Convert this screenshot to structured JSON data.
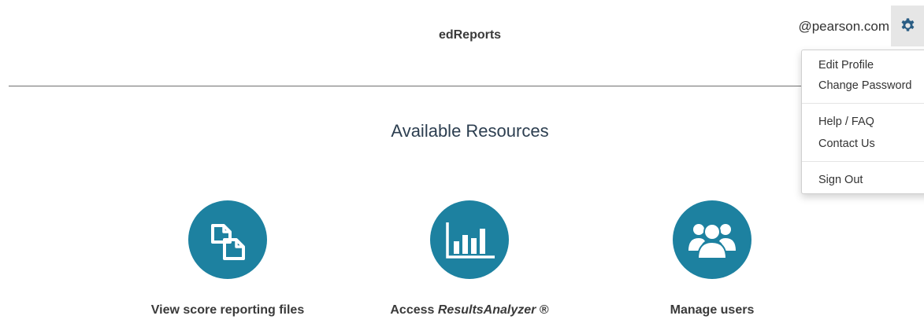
{
  "header": {
    "app_title": "edReports",
    "user_email": "@pearson.com",
    "settings_icon": "gear-icon"
  },
  "dropdown": {
    "items": [
      {
        "label": "Edit Profile"
      },
      {
        "label": "Change Password"
      },
      {
        "label": "Help / FAQ"
      },
      {
        "label": "Contact Us"
      },
      {
        "label": "Sign Out"
      }
    ]
  },
  "main": {
    "section_title": "Available Resources",
    "resources": [
      {
        "label": "View score reporting files",
        "icon": "copy-files-icon"
      },
      {
        "label_prefix": "Access ",
        "label_emphasis": "ResultsAnalyzer",
        "label_suffix": " ®",
        "icon": "bar-chart-icon"
      },
      {
        "label": "Manage users",
        "icon": "users-icon"
      }
    ]
  },
  "colors": {
    "accent": "#1d81a0",
    "title_text": "#2c3e50",
    "gear_icon": "#2a5d84",
    "gear_button_bg": "#e6e6e6"
  }
}
